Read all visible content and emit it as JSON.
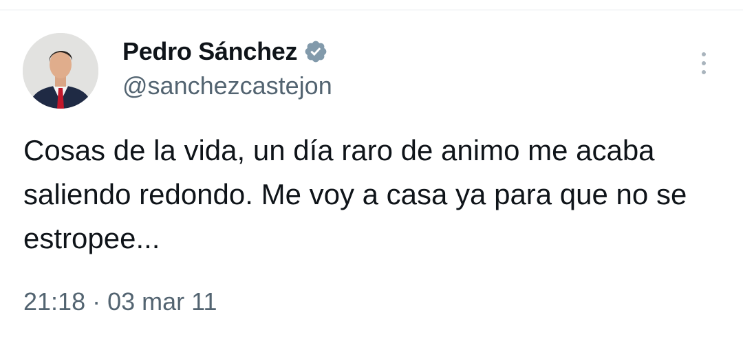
{
  "tweet": {
    "author": {
      "display_name": "Pedro Sánchez",
      "handle": "@sanchezcastejon",
      "verified_icon": "verified-badge-icon",
      "avatar_icon": "profile-photo"
    },
    "text": "Cosas de la vida, un día raro de animo me acaba saliendo redondo. Me voy a casa ya para que no se estropee...",
    "time": "21:18",
    "separator": "·",
    "date": "03 mar 11",
    "more_icon": "more-options-icon"
  },
  "colors": {
    "text_primary": "#0f1419",
    "text_secondary": "#536471",
    "verified_badge": "#829aab",
    "more_dots": "#a9b4bd",
    "divider": "#e6e9ec"
  }
}
